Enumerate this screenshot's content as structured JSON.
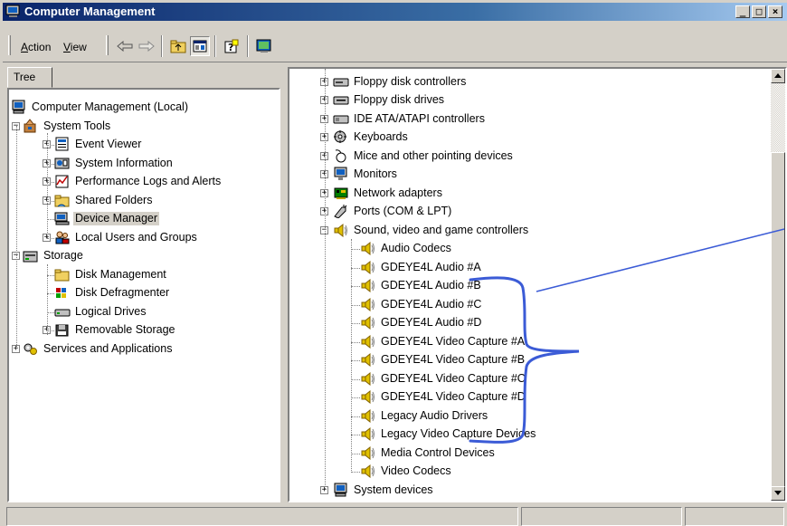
{
  "window": {
    "title": "Computer Management",
    "caption_buttons": [
      "_",
      "□",
      "×"
    ]
  },
  "menu": {
    "action": {
      "underline": "A",
      "rest": "ction"
    },
    "view": {
      "underline": "V",
      "rest": "iew"
    }
  },
  "toolbar_icons": [
    "back-arrow-icon",
    "forward-arrow-icon",
    "up-folder-icon",
    "show-hide-tree-icon",
    "properties-icon",
    "help-icon"
  ],
  "left": {
    "tab": "Tree",
    "tree": [
      {
        "label": "Computer Management (Local)",
        "icon": "computer-icon"
      },
      {
        "label": "System Tools",
        "icon": "system-tools-icon"
      },
      {
        "label": "Event Viewer",
        "icon": "event-viewer-icon"
      },
      {
        "label": "System Information",
        "icon": "system-information-icon"
      },
      {
        "label": "Performance Logs and Alerts",
        "icon": "performance-logs-icon"
      },
      {
        "label": "Shared Folders",
        "icon": "shared-folder-icon"
      },
      {
        "label": "Device Manager",
        "icon": "device-manager-icon"
      },
      {
        "label": "Local Users and Groups",
        "icon": "users-icon"
      },
      {
        "label": "Storage",
        "icon": "storage-icon"
      },
      {
        "label": "Disk Management",
        "icon": "folder-icon"
      },
      {
        "label": "Disk Defragmenter",
        "icon": "defragmenter-icon"
      },
      {
        "label": "Logical Drives",
        "icon": "drive-icon"
      },
      {
        "label": "Removable Storage",
        "icon": "removable-storage-icon"
      },
      {
        "label": "Services and Applications",
        "icon": "services-icon"
      }
    ]
  },
  "right": {
    "tree": [
      {
        "label": "Floppy disk controllers",
        "icon": "floppy-controller-icon"
      },
      {
        "label": "Floppy disk drives",
        "icon": "floppy-drive-icon"
      },
      {
        "label": "IDE ATA/ATAPI controllers",
        "icon": "ide-controller-icon"
      },
      {
        "label": "Keyboards",
        "icon": "keyboard-icon"
      },
      {
        "label": "Mice and other pointing devices",
        "icon": "mouse-icon"
      },
      {
        "label": "Monitors",
        "icon": "monitor-icon"
      },
      {
        "label": "Network adapters",
        "icon": "network-adapter-icon"
      },
      {
        "label": "Ports (COM & LPT)",
        "icon": "port-icon"
      },
      {
        "label": "Sound, video and game controllers",
        "icon": "speaker-icon"
      },
      {
        "label": "Audio Codecs",
        "icon": "speaker-icon"
      },
      {
        "label": "GDEYE4L Audio #A",
        "icon": "speaker-icon"
      },
      {
        "label": "GDEYE4L Audio #B",
        "icon": "speaker-icon"
      },
      {
        "label": "GDEYE4L Audio #C",
        "icon": "speaker-icon"
      },
      {
        "label": "GDEYE4L Audio #D",
        "icon": "speaker-icon"
      },
      {
        "label": "GDEYE4L Video Capture #A",
        "icon": "speaker-icon"
      },
      {
        "label": "GDEYE4L Video Capture #B",
        "icon": "speaker-icon"
      },
      {
        "label": "GDEYE4L Video Capture #C",
        "icon": "speaker-icon"
      },
      {
        "label": "GDEYE4L Video Capture #D",
        "icon": "speaker-icon"
      },
      {
        "label": "Legacy Audio Drivers",
        "icon": "speaker-icon"
      },
      {
        "label": "Legacy Video Capture Devices",
        "icon": "speaker-icon"
      },
      {
        "label": "Media Control Devices",
        "icon": "speaker-icon"
      },
      {
        "label": "Video Codecs",
        "icon": "speaker-icon"
      },
      {
        "label": "System devices",
        "icon": "computer-icon"
      }
    ]
  },
  "colors": {
    "title_bar": "#0a246a",
    "annotation": "#3b5bd6",
    "face": "#d4d0c8"
  }
}
